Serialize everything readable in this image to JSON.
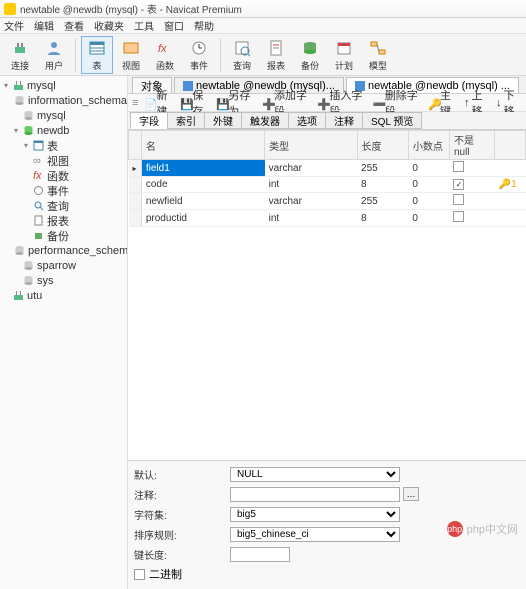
{
  "window": {
    "title": "newtable @newdb (mysql) - 表 - Navicat Premium"
  },
  "menu": [
    "文件",
    "编辑",
    "查看",
    "收藏夹",
    "工具",
    "窗口",
    "帮助"
  ],
  "toolbar": [
    {
      "label": "连接",
      "icon": "plug"
    },
    {
      "label": "用户",
      "icon": "user"
    },
    {
      "label": "表",
      "icon": "table",
      "sel": true
    },
    {
      "label": "视图",
      "icon": "view"
    },
    {
      "label": "函数",
      "icon": "fx"
    },
    {
      "label": "事件",
      "icon": "clock"
    },
    {
      "label": "查询",
      "icon": "query"
    },
    {
      "label": "报表",
      "icon": "report"
    },
    {
      "label": "备份",
      "icon": "backup"
    },
    {
      "label": "计划",
      "icon": "schedule"
    },
    {
      "label": "模型",
      "icon": "model"
    }
  ],
  "tree": [
    {
      "label": "mysql",
      "icon": "db-conn",
      "lvl": 0,
      "arrow": "▾"
    },
    {
      "label": "information_schema",
      "icon": "db",
      "lvl": 1
    },
    {
      "label": "mysql",
      "icon": "db",
      "lvl": 1
    },
    {
      "label": "newdb",
      "icon": "db-open",
      "lvl": 1,
      "arrow": "▾"
    },
    {
      "label": "表",
      "icon": "table",
      "lvl": 2,
      "arrow": "▾"
    },
    {
      "label": "视图",
      "icon": "view",
      "lvl": 2
    },
    {
      "label": "函数",
      "icon": "fx",
      "lvl": 2
    },
    {
      "label": "事件",
      "icon": "clock",
      "lvl": 2
    },
    {
      "label": "查询",
      "icon": "query",
      "lvl": 2
    },
    {
      "label": "报表",
      "icon": "report",
      "lvl": 2
    },
    {
      "label": "备份",
      "icon": "backup",
      "lvl": 2
    },
    {
      "label": "performance_schema",
      "icon": "db",
      "lvl": 1
    },
    {
      "label": "sparrow",
      "icon": "db",
      "lvl": 1
    },
    {
      "label": "sys",
      "icon": "db",
      "lvl": 1
    },
    {
      "label": "utu",
      "icon": "db-conn",
      "lvl": 0
    }
  ],
  "tabs": {
    "obj": "对象",
    "t1": "newtable @newdb (mysql)...",
    "t2": "newtable @newdb (mysql) ..."
  },
  "actions": {
    "new": "新建",
    "save": "保存",
    "saveas": "另存为",
    "addfield": "添加字段",
    "insertfield": "插入字段",
    "delfield": "删除字段",
    "primary": "主键",
    "up": "上移",
    "down": "下移"
  },
  "subtabs": [
    "字段",
    "索引",
    "外键",
    "触发器",
    "选项",
    "注释",
    "SQL 预览"
  ],
  "grid": {
    "headers": {
      "name": "名",
      "type": "类型",
      "len": "长度",
      "dec": "小数点",
      "notnull": "不是 null",
      "key": ""
    },
    "rows": [
      {
        "name": "field1",
        "type": "varchar",
        "len": "255",
        "dec": "0",
        "notnull": false,
        "key": false,
        "sel": true
      },
      {
        "name": "code",
        "type": "int",
        "len": "8",
        "dec": "0",
        "notnull": true,
        "key": true
      },
      {
        "name": "newfield",
        "type": "varchar",
        "len": "255",
        "dec": "0",
        "notnull": false,
        "key": false
      },
      {
        "name": "productid",
        "type": "int",
        "len": "8",
        "dec": "0",
        "notnull": false,
        "key": false
      }
    ]
  },
  "bottom": {
    "default_lbl": "默认:",
    "default_val": "NULL",
    "comment_lbl": "注释:",
    "comment_val": "",
    "charset_lbl": "字符集:",
    "charset_val": "big5",
    "collate_lbl": "排序规则:",
    "collate_val": "big5_chinese_ci",
    "keylen_lbl": "键长度:",
    "keylen_val": "",
    "binary_lbl": "二进制"
  },
  "watermark": "php中文网"
}
